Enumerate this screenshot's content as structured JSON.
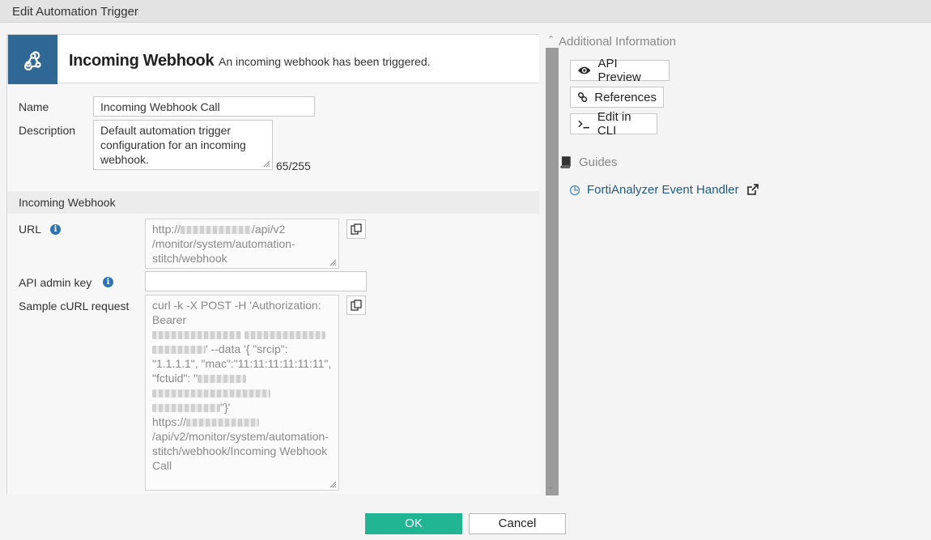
{
  "window": {
    "title": "Edit Automation Trigger"
  },
  "header": {
    "icon": "webhook-icon",
    "title": "Incoming Webhook",
    "description": "An incoming webhook has been triggered."
  },
  "form": {
    "name_label": "Name",
    "name_value": "Incoming Webhook Call",
    "description_label": "Description",
    "description_value": "Default automation trigger configuration for an incoming webhook.",
    "description_counter": "65/255",
    "section_title": "Incoming Webhook",
    "url_label": "URL",
    "url_prefix": "http://",
    "url_suffix": "/api/v2 /monitor/system/automation-stitch/webhook",
    "api_key_label": "API admin key",
    "api_key_value": "",
    "curl_label": "Sample cURL request",
    "curl_part1": "curl -k -X POST -H 'Authorization: Bearer",
    "curl_part2": "' --data '{ \"srcip\": \"1.1.1.1\", \"mac\":\"11:11:11:11:11:11\", \"fctuid\": \"",
    "curl_part3": "\"}'",
    "curl_part4": "https://",
    "curl_part5": "/api/v2/monitor/system/automation-stitch/webhook/Incoming Webhook Call"
  },
  "side": {
    "additional_info": "Additional Information",
    "api_preview": "API Preview",
    "references": "References",
    "edit_cli": "Edit in CLI",
    "guides": "Guides",
    "guide_link": "FortiAnalyzer Event Handler"
  },
  "footer": {
    "ok": "OK",
    "cancel": "Cancel"
  },
  "colors": {
    "header_icon_bg": "#2f6895",
    "ok_button": "#22b594",
    "link": "#1f5a8a",
    "info_icon": "#2e74b5"
  }
}
